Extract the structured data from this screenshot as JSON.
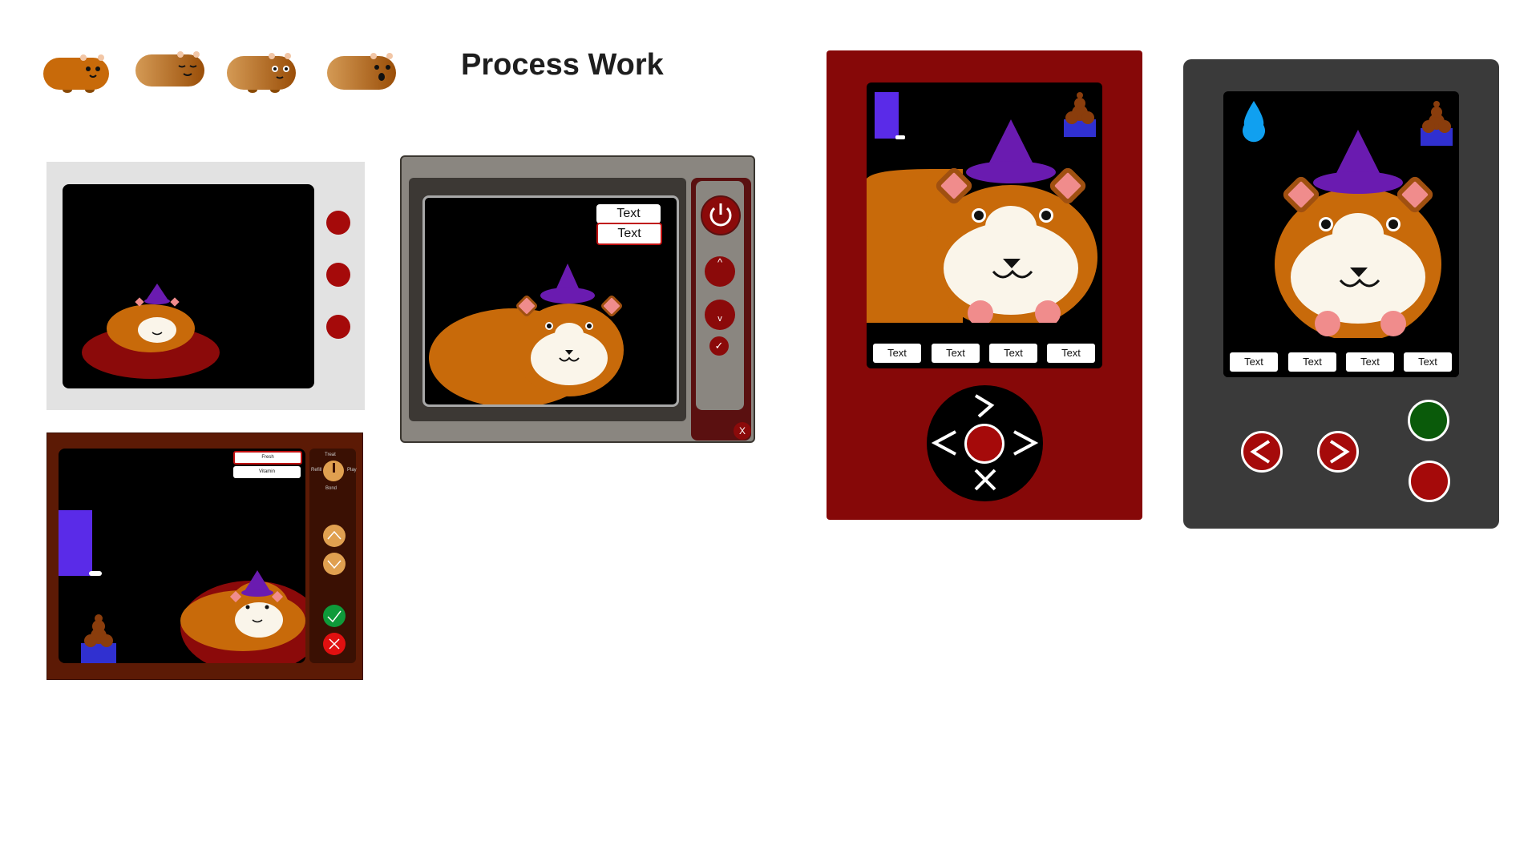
{
  "page": {
    "title": "Process Work"
  },
  "colors": {
    "guinea_orange": "#C86A0A",
    "guinea_face": "#FAF5EA",
    "hat_purple": "#6A1BB0",
    "ear_pink": "#F08C8C",
    "dark_red": "#8B0A0A",
    "button_red": "#A50A0A"
  },
  "mockup_microwave_white": {
    "buttons": [
      "red-dot",
      "red-dot",
      "red-dot"
    ]
  },
  "mockup_microwave_gray": {
    "menu": [
      "Text",
      "Text"
    ],
    "up_label": "^",
    "down_label": "v",
    "check_label": "✓",
    "close_label": "X"
  },
  "mockup_brown_panel": {
    "menu": [
      "Fresh",
      "Vitamin"
    ],
    "dial_labels": {
      "top": "Treat",
      "left": "Refill",
      "right": "Play",
      "bottom": "Bond"
    }
  },
  "mockup_red_device": {
    "tabs": [
      "Text",
      "Text",
      "Text",
      "Text"
    ]
  },
  "mockup_gray_device": {
    "tabs": [
      "Text",
      "Text",
      "Text",
      "Text"
    ]
  }
}
